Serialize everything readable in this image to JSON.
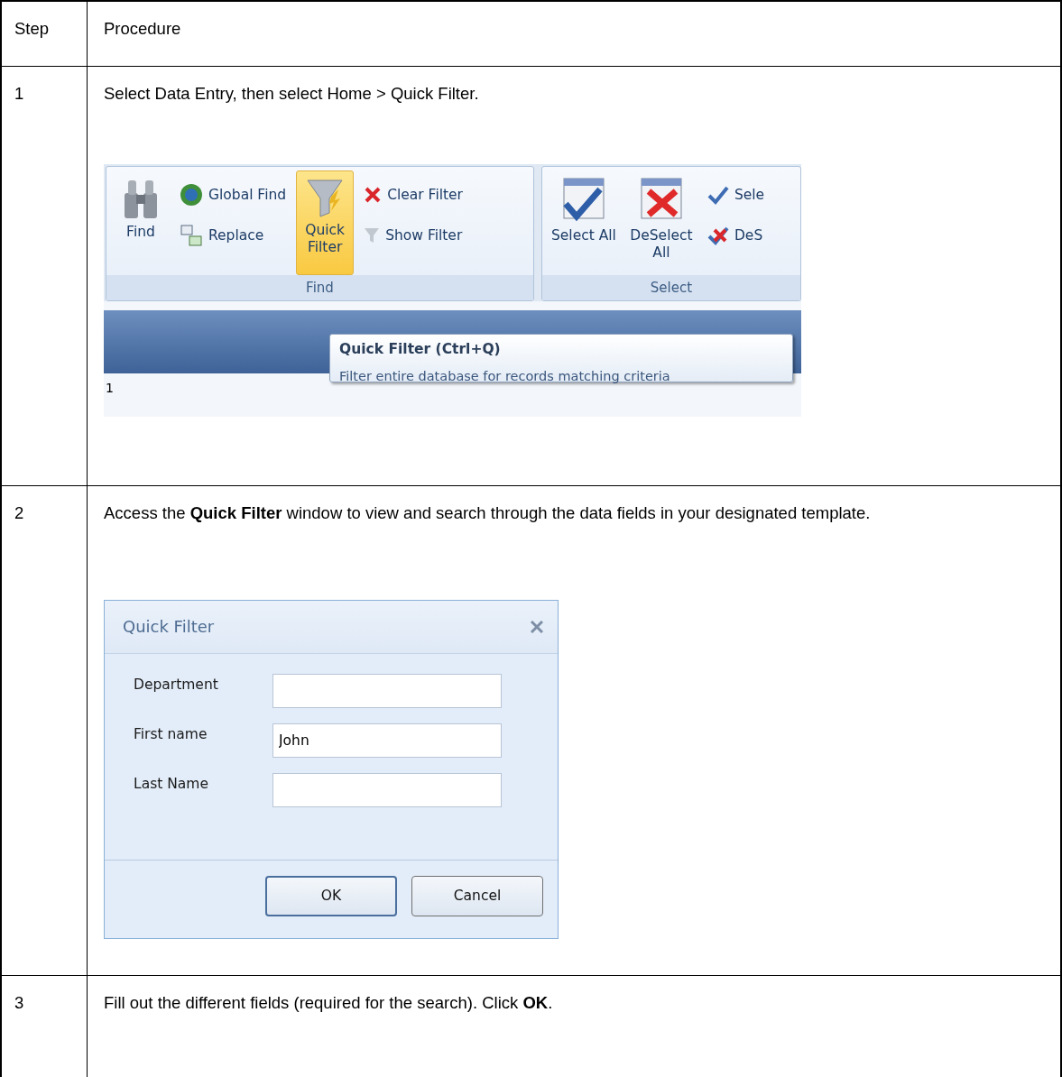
{
  "table": {
    "columns": [
      "Step",
      "Procedure"
    ],
    "rows": [
      {
        "step": "1",
        "text": "Select Data Entry, then select Home > Quick Filter.",
        "kind": "ribbon"
      },
      {
        "step": "2",
        "text": "Access the **Quick Filter** window to view and search through the data fields in your designated template.",
        "kind": "dialog"
      },
      {
        "step": "3",
        "text": "Fill out the different fields (required for the search). Click **OK**.",
        "kind": "text"
      }
    ]
  },
  "ribbon": {
    "groups": [
      {
        "label": "Find",
        "columns": [
          {
            "kind": "large",
            "items": [
              {
                "label": "Find",
                "highlighted": false
              }
            ]
          },
          {
            "kind": "stack",
            "items": [
              {
                "label": "Global Find",
                "highlighted": false
              },
              {
                "label": "Replace",
                "highlighted": false
              }
            ]
          },
          {
            "kind": "large",
            "items": [
              {
                "label": "Quick Filter",
                "highlighted": true
              }
            ]
          },
          {
            "kind": "stack",
            "items": [
              {
                "label": "Clear Filter",
                "highlighted": false
              },
              {
                "label": "Show Filter",
                "highlighted": false
              }
            ]
          }
        ]
      },
      {
        "label": "Select",
        "columns": [
          {
            "kind": "large",
            "items": [
              {
                "label": "Select All",
                "highlighted": false
              }
            ]
          },
          {
            "kind": "large",
            "items": [
              {
                "label": "DeSelect All",
                "highlighted": false
              }
            ]
          },
          {
            "kind": "stack",
            "items": [
              {
                "label": "Sele",
                "highlighted": false
              },
              {
                "label": "DeS",
                "highlighted": false
              }
            ]
          }
        ]
      }
    ],
    "grid_row_number": "1",
    "tooltip": {
      "title": "Quick Filter (Ctrl+Q)",
      "text": "Filter entire database for records matching criteria"
    }
  },
  "dialog": {
    "title": "Quick Filter",
    "fields": [
      {
        "label": "Department"
      },
      {
        "label": "First name",
        "value": "John"
      },
      {
        "label": "Last Name"
      }
    ],
    "buttons": [
      {
        "label": "OK",
        "default": true
      },
      {
        "label": "Cancel",
        "default": false
      }
    ]
  }
}
